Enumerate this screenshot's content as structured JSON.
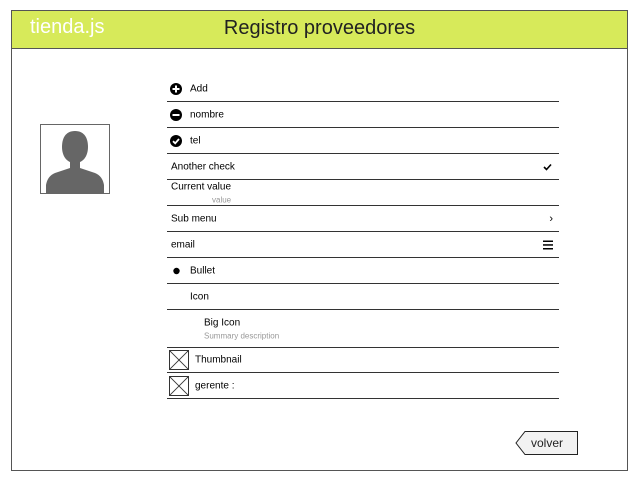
{
  "header": {
    "brand": "tienda.js",
    "title": "Registro proveedores",
    "accent": "#d7ea5a"
  },
  "avatar": {
    "icon": "user-silhouette-icon"
  },
  "list": {
    "add": "Add",
    "nombre": "nombre",
    "tel": "tel",
    "another_check": "Another check",
    "current_value_label": "Current value",
    "current_value_sub": "value",
    "sub_menu": "Sub menu",
    "email": "email",
    "bullet": "Bullet",
    "icon_item": "Icon",
    "big_icon": "Big Icon",
    "big_icon_desc": "Summary description",
    "thumbnail": "Thumbnail",
    "gerente": "gerente :"
  },
  "footer": {
    "back_label": "volver"
  }
}
